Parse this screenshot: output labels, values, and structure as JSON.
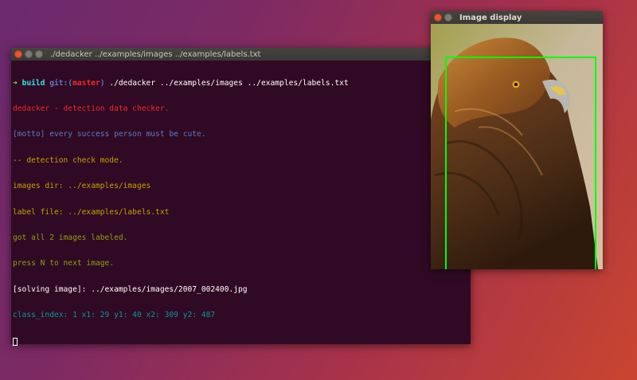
{
  "terminal": {
    "title": "./dedacker ../examples/images ../examples/labels.txt",
    "prompt": {
      "arrow": "➜",
      "dir": "build",
      "git_prefix": "git:(",
      "branch": "master",
      "git_suffix": ")",
      "command": "./dedacker ../examples/images ../examples/labels.txt"
    },
    "lines": [
      "dedacker - detection data checker.",
      "[motto] every success person must be cute.",
      "-- detection check mode.",
      "images dir: ../examples/images",
      "label file: ../examples/labels.txt",
      "got all 2 images labeled.",
      "press N to next image.",
      "[solving image]: ../examples/images/2007_002400.jpg",
      "class_index: 1 x1: 29 y1: 40 x2: 309 y2: 487"
    ]
  },
  "image_window": {
    "title": "Image display",
    "image_subject": "golden eagle photo",
    "bbox_color": "#00ff00"
  },
  "colors": {
    "terminal_bg": "#300a24",
    "close_button": "#e65531"
  }
}
